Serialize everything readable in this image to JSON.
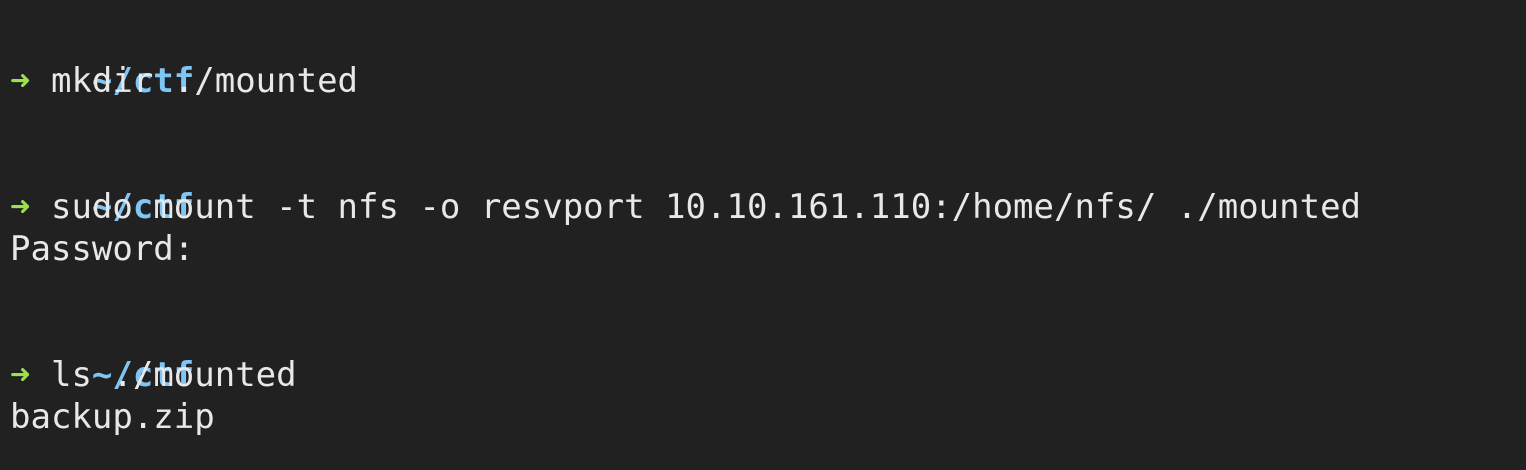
{
  "prompt": {
    "cwd": "~/ctf",
    "arrow": "➜"
  },
  "blocks": [
    {
      "command": "mkdir ./mounted",
      "output": []
    },
    {
      "command": "sudo mount -t nfs -o resvport 10.10.161.110:/home/nfs/ ./mounted",
      "output": [
        "Password:"
      ]
    },
    {
      "command": "ls ./mounted",
      "output": [
        "backup.zip"
      ]
    }
  ],
  "colors": {
    "background": "#212121",
    "cwd": "#7fc6f5",
    "arrow": "#9be14a",
    "text": "#e8e8e8"
  }
}
